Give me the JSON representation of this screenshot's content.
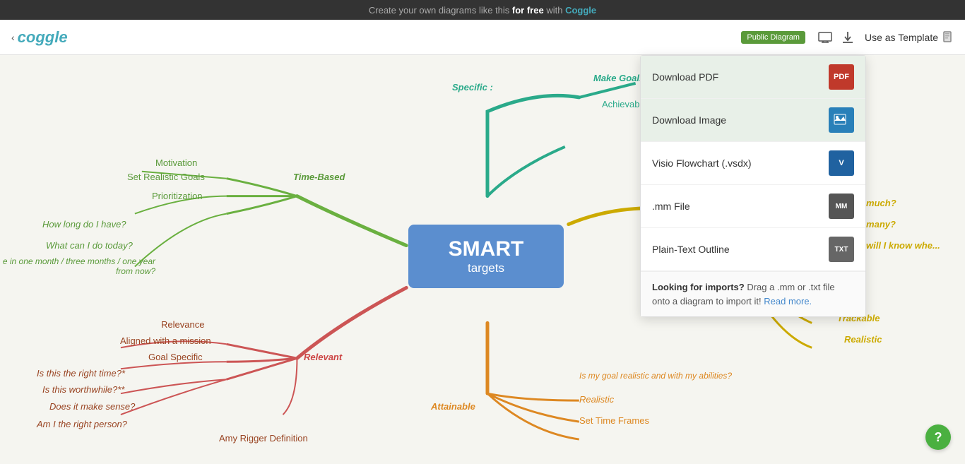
{
  "banner": {
    "text": "Create your own diagrams like this ",
    "bold": "for free",
    "suffix": " with ",
    "brand": "Coggle"
  },
  "header": {
    "back_arrow": "‹",
    "logo": "coggle",
    "public_badge": "Public Diagram",
    "monitor_icon": "⬜",
    "download_icon": "⬇",
    "template_label": "Use as Template",
    "template_icon": "📋"
  },
  "dropdown": {
    "items": [
      {
        "label": "Download PDF",
        "icon": "PDF",
        "color": "#c0392b"
      },
      {
        "label": "Download Image",
        "icon": "IMG",
        "color": "#2980b9",
        "highlighted": true
      },
      {
        "label": "Visio Flowchart (.vsdx)",
        "icon": "V",
        "color": "#2062a0"
      },
      {
        "label": ".mm File",
        "icon": "MM",
        "color": "#555"
      },
      {
        "label": "Plain-Text Outline",
        "icon": "TXT",
        "color": "#666"
      }
    ],
    "footer_bold": "Looking for imports?",
    "footer_text": " Drag a .mm or .txt file onto a diagram to import it! ",
    "read_more": "Read more."
  },
  "central_node": {
    "title": "SMART",
    "subtitle": "targets"
  },
  "branches": {
    "specific": {
      "label": "Specific",
      "sub": "Make Goals Specific",
      "sub2": "Achievable"
    },
    "time_based": {
      "label": "Time-Based",
      "items": [
        "Motivation",
        "Set Realistic Goals",
        "Prioritization"
      ]
    },
    "time_questions": [
      "How long do I have?",
      "What can I do today?",
      "e in one month / three months / one year from now?"
    ],
    "relevant": {
      "label": "Relevant",
      "items": [
        "Relevance",
        "Aligned with a mission",
        "Goal Specific"
      ]
    },
    "relevant_questions": [
      "Is this the right time?*",
      "Is this worthwhile?**",
      "Does it make sense?",
      "Am I the right person?"
    ],
    "amy": "Amy Rigger Definition",
    "measurable": {
      "items": [
        "How much?",
        "How many?",
        "How will I know whe..."
      ]
    },
    "measurable_bottom": [
      "Trackable",
      "Realistic"
    ],
    "attainable": {
      "label": "Attainable",
      "items": [
        "Is my goal realistic and with my abilities?",
        "Realistic",
        "Set Time Frames"
      ]
    }
  },
  "help_btn": "?"
}
